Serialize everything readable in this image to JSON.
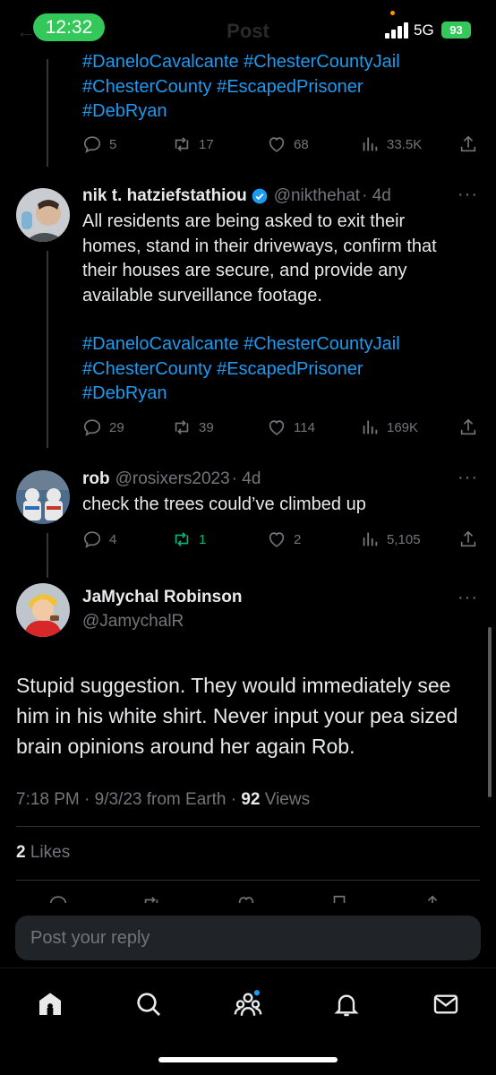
{
  "status_bar": {
    "time": "12:32",
    "network": "5G",
    "battery": "93",
    "header_title": "Post"
  },
  "tweet1": {
    "hashtags_line1": "#DaneloCavalcante #ChesterCountyJail",
    "hashtags_line2": "#ChesterCounty #EscapedPrisoner",
    "hashtags_line3": "#DebRyan",
    "replies": "5",
    "reposts": "17",
    "likes": "68",
    "views": "33.5K"
  },
  "tweet2": {
    "name": "nik t. hatziefstathiou",
    "handle": "@nikthehat",
    "time": "· 4d",
    "text_line1": "All residents are being asked to exit their",
    "text_line2": "homes, stand in their driveways, confirm that",
    "text_line3": "their houses are secure, and provide any",
    "text_line4": "available surveillance footage.",
    "hashtags_line1": "#DaneloCavalcante #ChesterCountyJail",
    "hashtags_line2": "#ChesterCounty #EscapedPrisoner",
    "hashtags_line3": "#DebRyan",
    "replies": "29",
    "reposts": "39",
    "likes": "114",
    "views": "169K"
  },
  "tweet3": {
    "name": "rob",
    "handle": "@rosixers2023",
    "time": "· 4d",
    "text": "check the trees could’ve climbed up",
    "replies": "4",
    "reposts": "1",
    "likes": "2",
    "views": "5,105"
  },
  "main_tweet": {
    "name": "JaMychal Robinson",
    "handle": "@JamychalR",
    "text_line1": "Stupid suggestion. They would immediately see",
    "text_line2": "him in his white shirt. Never input your pea sized",
    "text_line3": "brain opinions around her again Rob.",
    "timestamp": "7:18 PM · 9/3/23 from Earth · ",
    "views_count": "92",
    "views_label": " Views",
    "likes_count": "2",
    "likes_label": " Likes"
  },
  "reply": {
    "placeholder": "Post your reply"
  },
  "colors": {
    "background": "#000000",
    "link": "#1d9bf0",
    "muted": "#71767b",
    "repost_active": "#00ba7c",
    "status_green": "#34c759"
  },
  "icons": {
    "verified": "verified-badge-icon",
    "reply": "reply-icon",
    "repost": "repost-icon",
    "like": "heart-icon",
    "views": "views-icon",
    "share": "share-icon",
    "home": "home-icon",
    "search": "search-icon",
    "communities": "communities-icon",
    "notifications": "bell-icon",
    "messages": "mail-icon"
  }
}
